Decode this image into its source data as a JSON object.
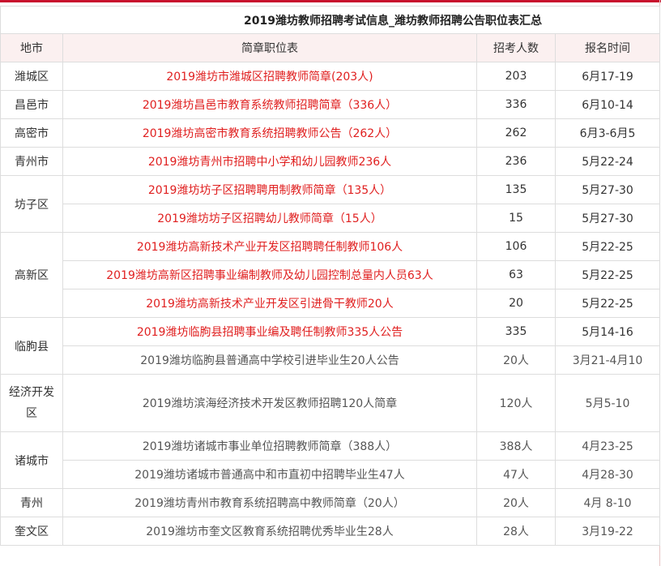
{
  "title": "2019潍坊教师招聘考试信息_潍坊教师招聘公告职位表汇总",
  "headers": [
    "地市",
    "简章职位表",
    "招考人数",
    "报名时间"
  ],
  "rows": [
    {
      "area": "潍城区",
      "link": "2019潍坊市潍城区招聘教师简章(203人)",
      "count": "203",
      "date": "6月17-19"
    },
    {
      "area": "昌邑市",
      "link": "2019潍坊昌邑市教育系统教师招聘简章（336人）",
      "count": "336",
      "date": "6月10-14"
    },
    {
      "area": "高密市",
      "link": "2019潍坊高密市教育系统招聘教师公告（262人）",
      "count": "262",
      "date": "6月3-6月5"
    },
    {
      "area": "青州市",
      "link": "2019潍坊青州市招聘中小学和幼儿园教师236人",
      "count": "236",
      "date": "5月22-24"
    },
    {
      "area": "坊子区",
      "link": "2019潍坊坊子区招聘聘用制教师简章（135人）",
      "count": "135",
      "date": "5月27-30"
    },
    {
      "area": "",
      "link": "2019潍坊坊子区招聘幼儿教师简章（15人）",
      "count": "15",
      "date": "5月27-30"
    },
    {
      "area": "高新区",
      "link": "2019潍坊高新技术产业开发区招聘聘任制教师106人",
      "count": "106",
      "date": "5月22-25"
    },
    {
      "area": "",
      "link": "2019潍坊高新区招聘事业编制教师及幼儿园控制总量内人员63人",
      "count": "63",
      "date": "5月22-25"
    },
    {
      "area": "",
      "link": "2019潍坊高新技术产业开发区引进骨干教师20人",
      "count": "20",
      "date": "5月22-25"
    },
    {
      "area": "临朐县",
      "link": "2019潍坊临朐县招聘事业编及聘任制教师335人公告",
      "count": "335",
      "date": "5月14-16"
    },
    {
      "area": "",
      "link": "2019潍坊临朐县普通高中学校引进毕业生20人公告",
      "count": "20人",
      "date": "3月21-4月10"
    },
    {
      "area": "经济开发区",
      "link": "2019潍坊滨海经济技术开发区教师招聘120人简章",
      "count": "120人",
      "date": "5月5-10"
    },
    {
      "area": "诸城市",
      "link": "2019潍坊诸城市事业单位招聘教师简章（388人）",
      "count": "388人",
      "date": "4月23-25"
    },
    {
      "area": "",
      "link": "2019潍坊诸城市普通高中和市直初中招聘毕业生47人",
      "count": "47人",
      "date": "4月28-30"
    },
    {
      "area": "青州",
      "link": "2019潍坊青州市教育系统招聘高中教师简章（20人）",
      "count": "20人",
      "date": "4月 8-10"
    },
    {
      "area": "奎文区",
      "link": "2019潍坊市奎文区教育系统招聘优秀毕业生28人",
      "count": "28人",
      "date": "3月19-22"
    }
  ],
  "colors": {
    "link": "#e01f1f",
    "header_bg": "#fbf0f0",
    "top_bar": "#c8102e"
  }
}
